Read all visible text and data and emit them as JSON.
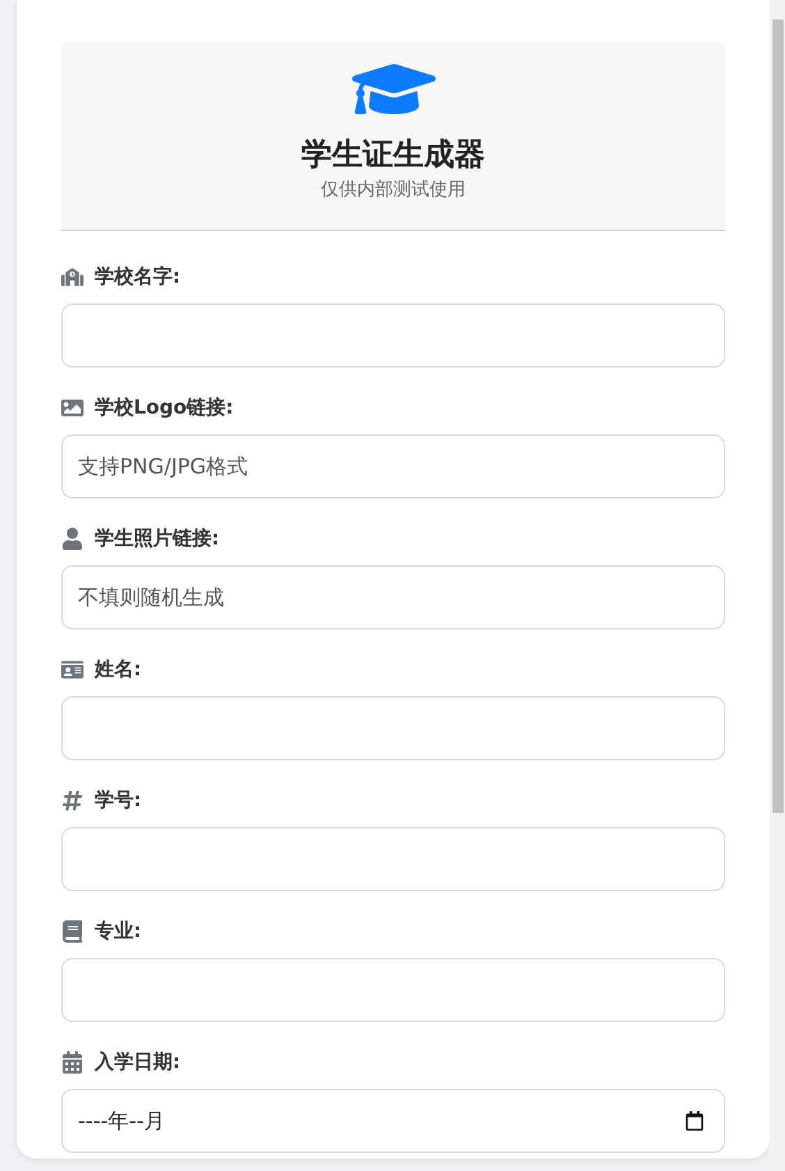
{
  "header": {
    "title": "学生证生成器",
    "subtitle": "仅供内部测试使用"
  },
  "fields": [
    {
      "kind": "school",
      "label": "学校名字:"
    },
    {
      "kind": "image",
      "label": "学校Logo链接:",
      "placeholder": "支持PNG/JPG格式"
    },
    {
      "kind": "user",
      "label": "学生照片链接:",
      "placeholder": "不填则随机生成"
    },
    {
      "kind": "idcard",
      "label": "姓名:"
    },
    {
      "kind": "hash",
      "label": "学号:"
    },
    {
      "kind": "book",
      "label": "专业:"
    },
    {
      "kind": "calendar",
      "label": "入学日期:",
      "value": "----年--月"
    }
  ]
}
